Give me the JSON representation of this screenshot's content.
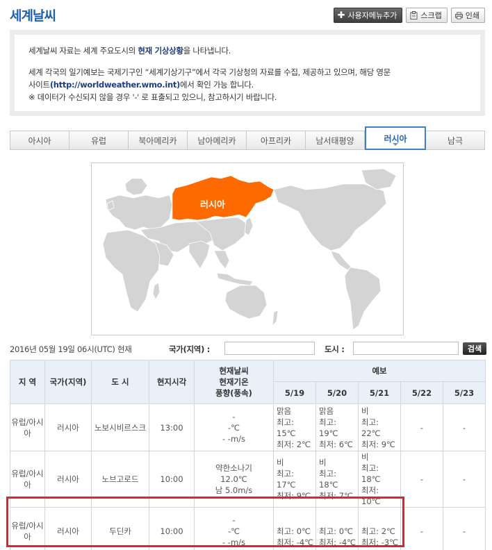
{
  "page": {
    "title": "세계날씨"
  },
  "actions": {
    "add_menu": "사용자메뉴추가",
    "scrap": "스크랩",
    "print": "인쇄"
  },
  "info": {
    "line1_pre": "세계날씨 자료는 세계 주요도시의 ",
    "line1_bold": "현재 기상상황",
    "line1_post": "을 나타냅니다.",
    "line2": "세계 각국의 일기예보는 국제기구인 “세계기상기구”에서 각국 기상청의 자료를 수집, 제공하고 있으며, 해당 영문",
    "line3_pre": "사이트",
    "line3_link": "(http://worldweather.wmo.int)",
    "line3_post": "에서 확인 가능 합니다.",
    "line4": "※ 데이터가 수신되지 않을 경우 '-' 로 표출되고 있으니, 참고하시기 바랍니다."
  },
  "tabs": [
    "아시아",
    "유럽",
    "북아메리카",
    "남아메리카",
    "아프리카",
    "남서태평양",
    "러시아",
    "남극"
  ],
  "active_tab": "러시아",
  "map": {
    "region_label": "러시아",
    "highlight_color": "#ff6a00",
    "land_color": "#d4d4d4"
  },
  "search": {
    "time": "2016년 05월 19일 06시(UTC) 현재",
    "country_label": "국가(지역) :",
    "city_label": "도시 :",
    "button": "검색"
  },
  "table": {
    "h_region": "지 역",
    "h_country": "국가(지역)",
    "h_city": "도 시",
    "h_local": "현지시각",
    "h_current": "현재날씨\n현재기온\n풍향(풍속)",
    "h_forecast": "예보",
    "dates": [
      "5/19",
      "5/20",
      "5/21",
      "5/22",
      "5/23"
    ],
    "rows": [
      {
        "region": "유럽/아시아",
        "country": "러시아",
        "city": "노보시비르스크",
        "time": "13:00",
        "current": "-\n-℃\n- -m/s",
        "fc": [
          "맑음\n최고: 15℃\n최저: 2℃",
          "맑음\n최고: 19℃\n최저: 6℃",
          "비\n최고: 22℃\n최저: 9℃",
          "-",
          "-"
        ]
      },
      {
        "region": "유럽/아시아",
        "country": "러시아",
        "city": "노브고로드",
        "time": "10:00",
        "current": "약한소나기\n12.0℃\n남 5.0m/s",
        "fc": [
          "비\n최고: 17℃\n최저: 9℃",
          "비\n최고: 18℃\n최저: 7℃",
          "비\n최고: 18℃\n최저: 10℃",
          "-",
          "-"
        ]
      },
      {
        "region": "유럽/아시아",
        "country": "러시아",
        "city": "두딘카",
        "time": "10:00",
        "current": "-\n-℃\n- -m/s",
        "fc": [
          "\n최고: 0℃\n최저: -4℃",
          "\n최고: 0℃\n최저: -4℃",
          "\n최고: 2℃\n최저: -3℃",
          "-",
          "-"
        ]
      }
    ]
  }
}
